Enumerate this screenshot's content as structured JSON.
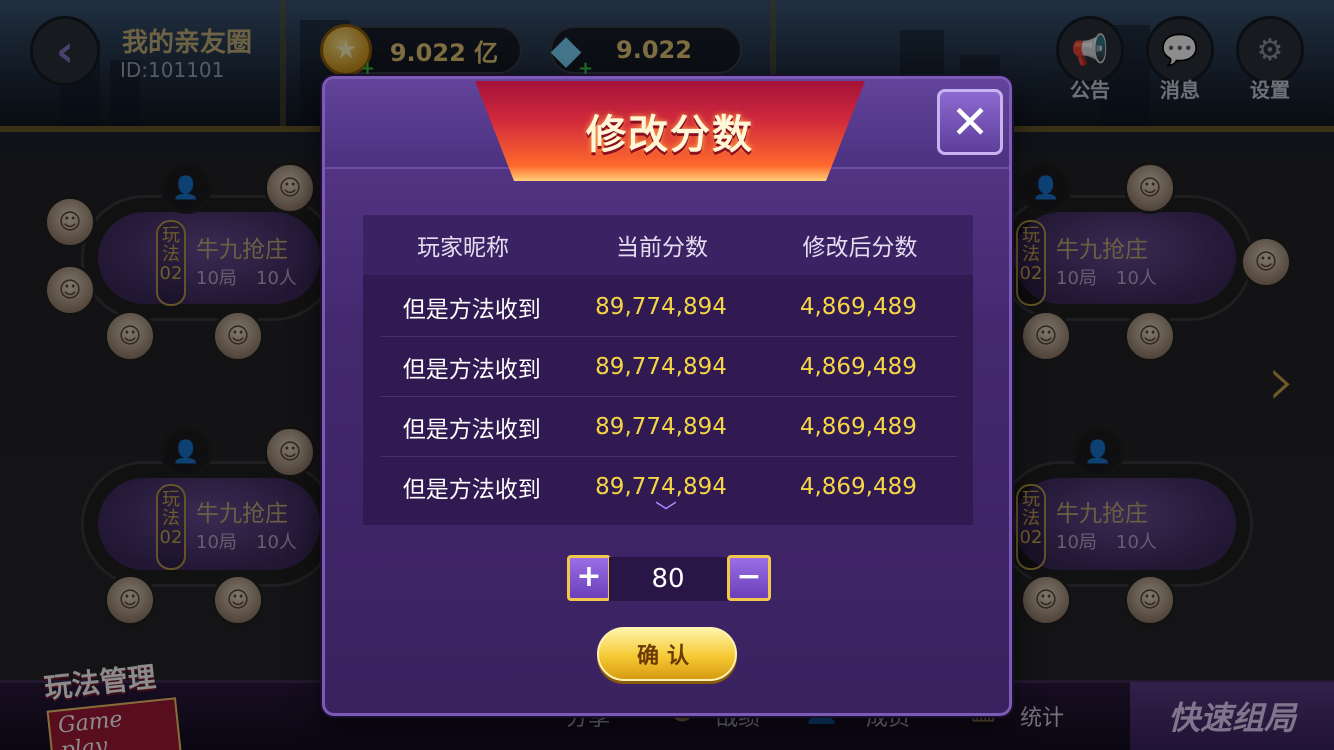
{
  "header": {
    "circle_name": "我的亲友圈",
    "circle_id": "ID:101101",
    "coins": "9.022 亿",
    "diamonds": "9.022",
    "announcement_label": "公告",
    "message_label": "消息",
    "settings_label": "设置"
  },
  "tables": [
    {
      "mode": "玩法02",
      "name": "牛九抢庄",
      "rounds": "10局",
      "players": "10人"
    },
    {
      "mode": "玩法02",
      "name": "牛九抢庄",
      "rounds": "10局",
      "players": "10人"
    },
    {
      "mode": "玩法02",
      "name": "牛九抢庄",
      "rounds": "10局",
      "players": "10人"
    },
    {
      "mode": "玩法02",
      "name": "牛九抢庄",
      "rounds": "10局",
      "players": "10人"
    }
  ],
  "bottom": {
    "mode_manage_cn": "玩法管理",
    "mode_manage_en": "Game play",
    "share_label": "分享",
    "record_label": "战绩",
    "member_label": "成员",
    "stats_label": "统计",
    "quick_group_label": "快速组局"
  },
  "modal": {
    "title": "修改分数",
    "columns": [
      "玩家昵称",
      "当前分数",
      "修改后分数"
    ],
    "rows": [
      {
        "nickname": "但是方法收到",
        "current": "89,774,894",
        "after": "4,869,489"
      },
      {
        "nickname": "但是方法收到",
        "current": "89,774,894",
        "after": "4,869,489"
      },
      {
        "nickname": "但是方法收到",
        "current": "89,774,894",
        "after": "4,869,489"
      },
      {
        "nickname": "但是方法收到",
        "current": "89,774,894",
        "after": "4,869,489"
      }
    ],
    "stepper_value": "80",
    "plus_label": "+",
    "minus_label": "−",
    "confirm_label": "确认"
  },
  "colors": {
    "accent_gold": "#f4d646",
    "modal_purple": "#43286e",
    "title_red": "#d12a3c"
  }
}
